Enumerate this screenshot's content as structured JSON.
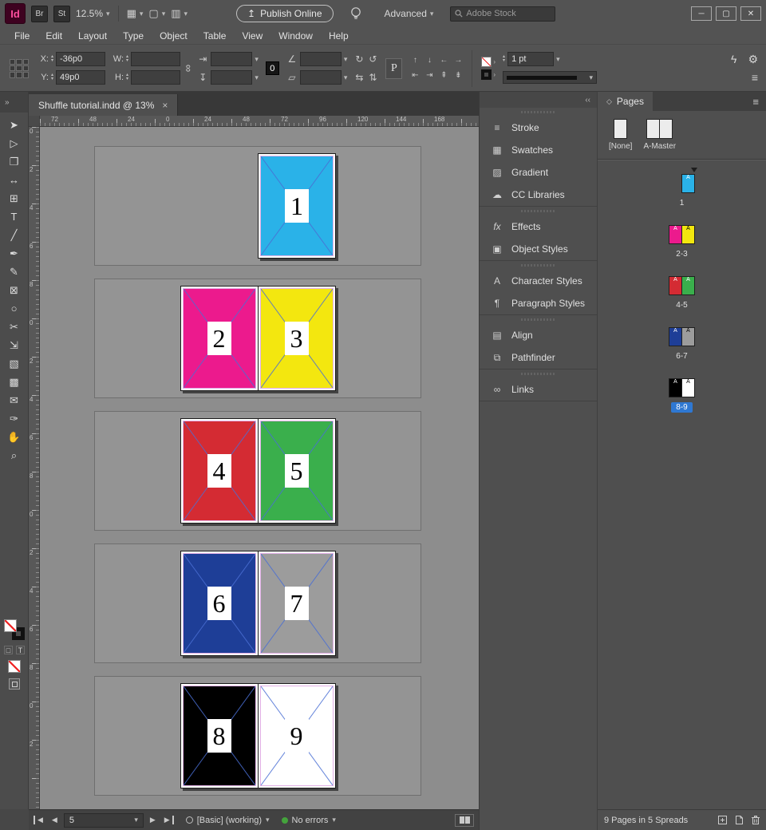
{
  "titlebar": {
    "logo": "Id",
    "bridge": "Br",
    "stock_badge": "St",
    "zoom": "12.5%",
    "publish": "Publish Online",
    "workspace": "Advanced",
    "search_placeholder": "Adobe Stock",
    "min": "─",
    "restore": "▢",
    "close": "✕"
  },
  "icons": {
    "chevron": "▾",
    "publish_arrow": "↥",
    "quick_apply": "ϟ",
    "gear": "⚙",
    "panel_menu": "≡",
    "collapse": "‹‹",
    "expand": "»",
    "view_options": "▦",
    "screen_mode": "▢",
    "arrange": "▥",
    "link": "∞",
    "rotate_cw": "↻",
    "rotate_ccw": "↺",
    "flip_h": "⇆",
    "flip_v": "⇅",
    "scale_w": "⇥",
    "scale_h": "↧",
    "angle": "∠",
    "shear": "▱",
    "diamond": "◇",
    "nav_prev": "◀",
    "nav_next": "▶",
    "arrow_small": "›",
    "up": "▴",
    "down": "▾"
  },
  "menubar": [
    "File",
    "Edit",
    "Layout",
    "Type",
    "Object",
    "Table",
    "View",
    "Window",
    "Help"
  ],
  "controlbar": {
    "x_label": "X:",
    "x_value": "-36p0",
    "y_label": "Y:",
    "y_value": "49p0",
    "w_label": "W:",
    "w_value": "",
    "h_label": "H:",
    "h_value": "",
    "zero": "0",
    "p": "P",
    "stroke_weight": "1 pt",
    "cluster_row1": [
      "↑",
      "↓",
      "←",
      "→"
    ],
    "cluster_row2": [
      "⇤",
      "⇥",
      "⇞",
      "⇟"
    ]
  },
  "tab": {
    "title": "Shuffle tutorial.indd @ 13%",
    "close": "×"
  },
  "rulers": {
    "h": [
      "72",
      "48",
      "24",
      "0",
      "24",
      "48",
      "72",
      "96",
      "120",
      "144",
      "168"
    ],
    "v": [
      "0",
      "2",
      "4",
      "6",
      "8",
      "0",
      "2",
      "4",
      "6",
      "8",
      "0",
      "2",
      "4",
      "6",
      "8",
      "0",
      "2"
    ]
  },
  "tools": [
    {
      "name": "selection-tool",
      "glyph": "➤"
    },
    {
      "name": "direct-selection-tool",
      "glyph": "▷"
    },
    {
      "name": "page-tool",
      "glyph": "❐"
    },
    {
      "name": "gap-tool",
      "glyph": "↔"
    },
    {
      "name": "content-collector-tool",
      "glyph": "⊞"
    },
    {
      "name": "type-tool",
      "glyph": "T"
    },
    {
      "name": "line-tool",
      "glyph": "╱"
    },
    {
      "name": "pen-tool",
      "glyph": "✒"
    },
    {
      "name": "pencil-tool",
      "glyph": "✎"
    },
    {
      "name": "rectangle-frame-tool",
      "glyph": "⊠"
    },
    {
      "name": "ellipse-frame-tool",
      "glyph": "○"
    },
    {
      "name": "scissors-tool",
      "glyph": "✂"
    },
    {
      "name": "free-transform-tool",
      "glyph": "⇲"
    },
    {
      "name": "gradient-swatch-tool",
      "glyph": "▧"
    },
    {
      "name": "gradient-feather-tool",
      "glyph": "▩"
    },
    {
      "name": "note-tool",
      "glyph": "✉"
    },
    {
      "name": "eyedropper-tool",
      "glyph": "✑"
    },
    {
      "name": "hand-tool",
      "glyph": "✋"
    },
    {
      "name": "zoom-tool",
      "glyph": "⌕"
    }
  ],
  "spreads": [
    {
      "label": "1",
      "selected": false,
      "marker": true,
      "pages": [
        {
          "num": "1",
          "color": "#2ab2e8",
          "a": "#ffffff"
        }
      ]
    },
    {
      "label": "2-3",
      "selected": false,
      "marker": false,
      "pages": [
        {
          "num": "2",
          "color": "#ec1a8d",
          "a": "#ffffff"
        },
        {
          "num": "3",
          "color": "#f3e70f",
          "a": "#000000"
        }
      ]
    },
    {
      "label": "4-5",
      "selected": false,
      "marker": false,
      "pages": [
        {
          "num": "4",
          "color": "#d42b33",
          "a": "#ffffff"
        },
        {
          "num": "5",
          "color": "#3aaf4c",
          "a": "#ffffff"
        }
      ]
    },
    {
      "label": "6-7",
      "selected": false,
      "marker": false,
      "pages": [
        {
          "num": "6",
          "color": "#1e3e97",
          "a": "#ffffff"
        },
        {
          "num": "7",
          "color": "#9c9c9c",
          "a": "#000000"
        }
      ]
    },
    {
      "label": "8-9",
      "selected": true,
      "marker": false,
      "pages": [
        {
          "num": "8",
          "color": "#000000",
          "a": "#ffffff"
        },
        {
          "num": "9",
          "color": "#ffffff",
          "a": "#000000"
        }
      ]
    }
  ],
  "panel_groups": [
    {
      "items": [
        {
          "label": "Stroke",
          "glyph": "≡"
        },
        {
          "label": "Swatches",
          "glyph": "▦"
        },
        {
          "label": "Gradient",
          "glyph": "▨"
        },
        {
          "label": "CC Libraries",
          "glyph": "☁"
        }
      ]
    },
    {
      "items": [
        {
          "label": "Effects",
          "glyph": "fx"
        },
        {
          "label": "Object Styles",
          "glyph": "▣"
        }
      ]
    },
    {
      "items": [
        {
          "label": "Character Styles",
          "glyph": "A"
        },
        {
          "label": "Paragraph Styles",
          "glyph": "¶"
        }
      ]
    },
    {
      "items": [
        {
          "label": "Align",
          "glyph": "▤"
        },
        {
          "label": "Pathfinder",
          "glyph": "⧉"
        }
      ]
    },
    {
      "items": [
        {
          "label": "Links",
          "glyph": "∞"
        }
      ]
    }
  ],
  "pages_panel": {
    "title": "Pages",
    "masters": [
      {
        "label": "[None]",
        "pages": 1
      },
      {
        "label": "A-Master",
        "pages": 2
      }
    ],
    "master_letter": "A",
    "status": "9 Pages in 5 Spreads"
  },
  "statusbar": {
    "page": "5",
    "preflight": "[Basic] (working)",
    "errors": "No errors"
  }
}
